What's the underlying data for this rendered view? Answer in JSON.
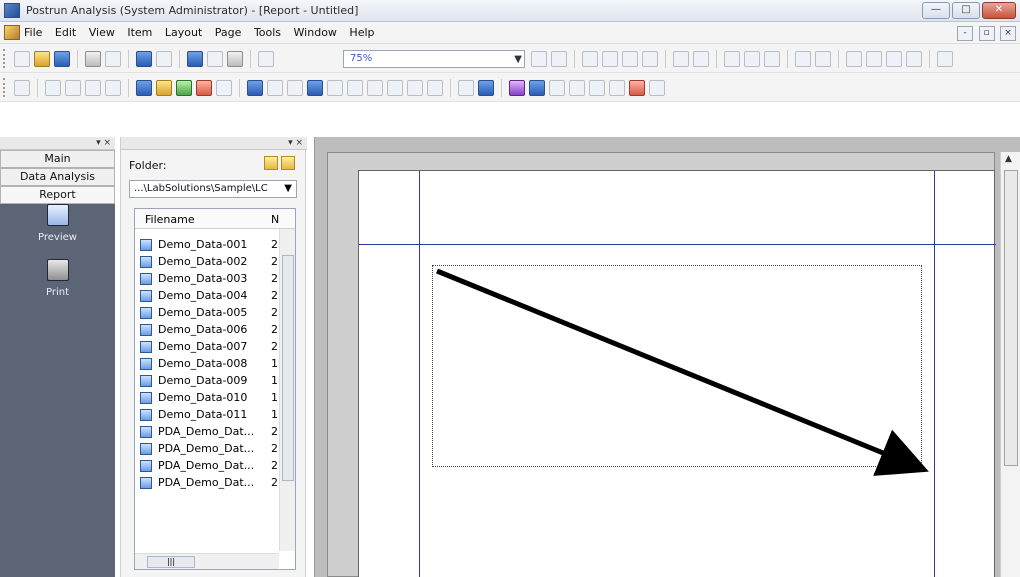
{
  "window": {
    "title": "Postrun Analysis (System Administrator) - [Report - Untitled]",
    "controls": [
      "—",
      "□",
      "✕"
    ]
  },
  "menu": {
    "items": [
      "File",
      "Edit",
      "View",
      "Item",
      "Layout",
      "Page",
      "Tools",
      "Window",
      "Help"
    ],
    "mdi_controls": [
      "-",
      "▫",
      "×"
    ]
  },
  "toolbar": {
    "zoom_value": "75%"
  },
  "left_panel": {
    "tabs": [
      "Main",
      "Data Analysis",
      "Report"
    ],
    "items": [
      {
        "label": "Preview",
        "icon": "preview-icon"
      },
      {
        "label": "Print",
        "icon": "print-icon"
      }
    ]
  },
  "file_panel": {
    "folder_label": "Folder:",
    "folder_path": "...\\LabSolutions\\Sample\\LC",
    "columns": [
      "Filename",
      "N"
    ],
    "rows": [
      {
        "name": "Demo_Data-001",
        "n": "2"
      },
      {
        "name": "Demo_Data-002",
        "n": "2"
      },
      {
        "name": "Demo_Data-003",
        "n": "2"
      },
      {
        "name": "Demo_Data-004",
        "n": "2"
      },
      {
        "name": "Demo_Data-005",
        "n": "2"
      },
      {
        "name": "Demo_Data-006",
        "n": "2"
      },
      {
        "name": "Demo_Data-007",
        "n": "2"
      },
      {
        "name": "Demo_Data-008",
        "n": "1"
      },
      {
        "name": "Demo_Data-009",
        "n": "1"
      },
      {
        "name": "Demo_Data-010",
        "n": "1"
      },
      {
        "name": "Demo_Data-011",
        "n": "1"
      },
      {
        "name": "PDA_Demo_Dat...",
        "n": "2"
      },
      {
        "name": "PDA_Demo_Dat...",
        "n": "2"
      },
      {
        "name": "PDA_Demo_Dat...",
        "n": "2"
      },
      {
        "name": "PDA_Demo_Dat...",
        "n": "2"
      }
    ]
  },
  "document": {
    "page_label": "Report - Untitled"
  }
}
